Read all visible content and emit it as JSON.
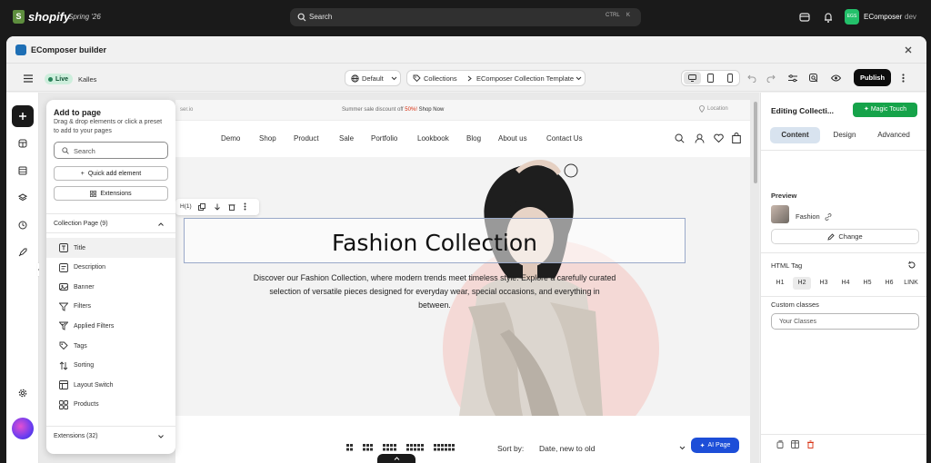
{
  "shopify": {
    "brand": "shopify",
    "edition": "Spring '26",
    "search_placeholder": "Search",
    "shortcut_1": "CTRL",
    "shortcut_2": "K",
    "store_initials": "EGS",
    "store_name": "EComposer",
    "store_tag": "dev"
  },
  "window": {
    "title": "EComposer builder"
  },
  "toolbar": {
    "live": "Live",
    "theme": "Kalles",
    "template_select": "Default",
    "breadcrumb_1": "Collections",
    "breadcrumb_2": "EComposer Collection Template",
    "publish": "Publish"
  },
  "storefront": {
    "url_fragment": "ser.io",
    "announcement_prefix": "Summer sale discount off ",
    "announcement_highlight": "50%!",
    "announcement_link": "Shop Now",
    "location": "Location",
    "nav": [
      "Demo",
      "Shop",
      "Product",
      "Sale",
      "Portfolio",
      "Lookbook",
      "Blog",
      "About us",
      "Contact Us"
    ],
    "hero_title": "Fashion Collection",
    "hero_desc_1": "Discover our Fashion Collection, where modern trends meet timeless style. Explore a carefully curated",
    "hero_desc_2": "selection of versatile pieces designed for everyday wear, special occasions, and everything in",
    "hero_desc_3": "between.",
    "selected_toolbar_label": "H(1)",
    "sort_label": "Sort by:",
    "sort_value": "Date, new to old",
    "ai_page": "AI Page"
  },
  "add_panel": {
    "title": "Add to page",
    "subtitle": "Drag & drop elements or click a preset to add to your pages",
    "search_placeholder": "Search",
    "quick_add": "Quick add element",
    "extensions_btn": "Extensions",
    "group_label": "Collection Page (9)",
    "items": [
      {
        "label": "Title",
        "icon": "title-icon"
      },
      {
        "label": "Description",
        "icon": "description-icon"
      },
      {
        "label": "Banner",
        "icon": "banner-icon"
      },
      {
        "label": "Filters",
        "icon": "filter-icon"
      },
      {
        "label": "Applied Filters",
        "icon": "applied-filter-icon"
      },
      {
        "label": "Tags",
        "icon": "tag-icon"
      },
      {
        "label": "Sorting",
        "icon": "sort-icon"
      },
      {
        "label": "Layout Switch",
        "icon": "layout-icon"
      },
      {
        "label": "Products",
        "icon": "grid-icon"
      }
    ],
    "extensions_group": "Extensions (32)"
  },
  "right_panel": {
    "title": "Editing Collecti...",
    "magic_touch": "Magic Touch",
    "tabs": [
      "Content",
      "Design",
      "Advanced"
    ],
    "active_tab": "Content",
    "preview_label": "Preview",
    "preview_name": "Fashion",
    "change": "Change",
    "html_tag_label": "HTML Tag",
    "tags": [
      "H1",
      "H2",
      "H3",
      "H4",
      "H5",
      "H6",
      "LINK"
    ],
    "selected_tag": "H2",
    "custom_classes_label": "Custom classes",
    "custom_classes_placeholder": "Your Classes"
  },
  "colors": {
    "accent_green": "#16a34a",
    "selection_blue": "#9aa9c9",
    "sale_red": "#d72c0d"
  }
}
